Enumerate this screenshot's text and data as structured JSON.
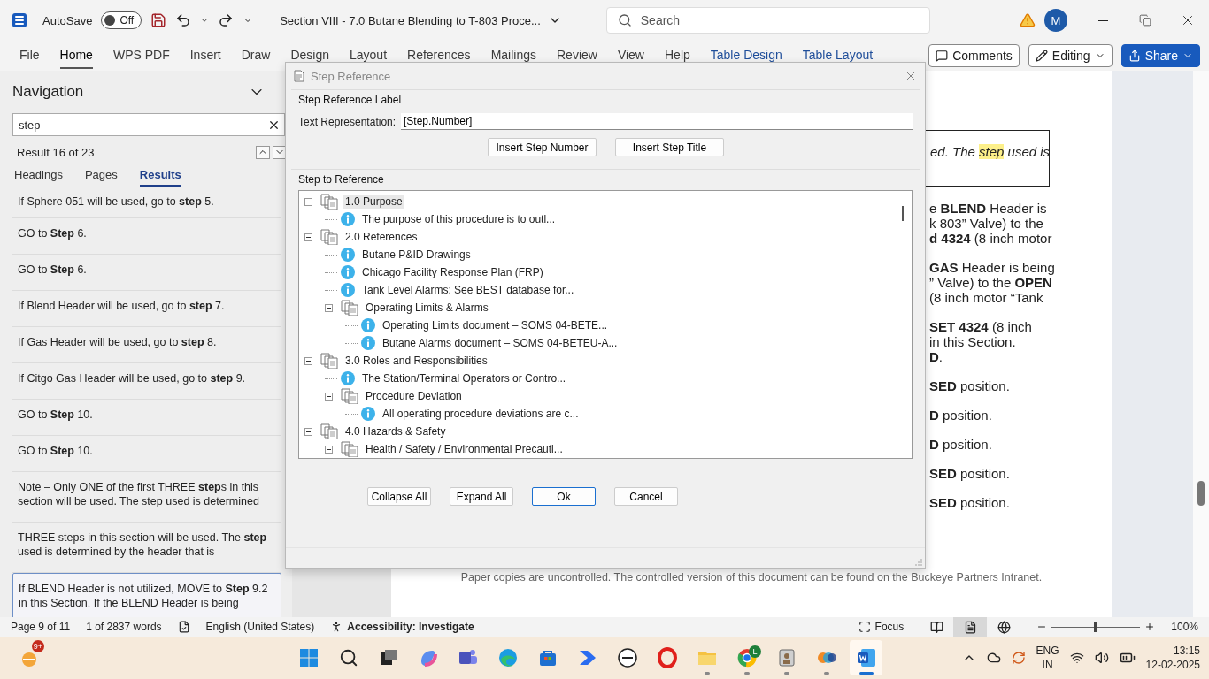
{
  "title_bar": {
    "autosave_label": "AutoSave",
    "autosave_toggle": {
      "label": "Off",
      "on": false
    },
    "document_title": "Section VIII - 7.0 Butane Blending to T-803 Proce...",
    "search_placeholder": "Search",
    "avatar": "M"
  },
  "ribbon": {
    "tabs": [
      {
        "label": "File",
        "selected": false,
        "kind": "normal"
      },
      {
        "label": "Home",
        "selected": true,
        "kind": "normal"
      },
      {
        "label": "WPS PDF",
        "selected": false,
        "kind": "normal"
      },
      {
        "label": "Insert",
        "selected": false,
        "kind": "normal"
      },
      {
        "label": "Draw",
        "selected": false,
        "kind": "normal"
      },
      {
        "label": "Design",
        "selected": false,
        "kind": "normal"
      },
      {
        "label": "Layout",
        "selected": false,
        "kind": "normal"
      },
      {
        "label": "References",
        "selected": false,
        "kind": "normal"
      },
      {
        "label": "Mailings",
        "selected": false,
        "kind": "normal"
      },
      {
        "label": "Review",
        "selected": false,
        "kind": "normal"
      },
      {
        "label": "View",
        "selected": false,
        "kind": "normal"
      },
      {
        "label": "Help",
        "selected": false,
        "kind": "normal"
      },
      {
        "label": "Table Design",
        "selected": false,
        "kind": "contextual"
      },
      {
        "label": "Table Layout",
        "selected": false,
        "kind": "contextual"
      }
    ],
    "comments": "Comments",
    "editing": "Editing",
    "share": "Share"
  },
  "navigation": {
    "title": "Navigation",
    "search_value": "step",
    "result_count": "Result 16 of 23",
    "tabs": [
      {
        "label": "Headings",
        "selected": false
      },
      {
        "label": "Pages",
        "selected": false
      },
      {
        "label": "Results",
        "selected": true
      }
    ],
    "results": [
      {
        "text": "If Sphere 051 will be used, go to **step** 5.",
        "selected": false
      },
      {
        "text": "GO to **Step** 6.",
        "selected": false
      },
      {
        "text": "GO to **Step** 6.",
        "selected": false
      },
      {
        "text": "If Blend Header will be used, go to **step** 7.",
        "selected": false
      },
      {
        "text": "If Gas Header will be used, go to **step** 8.",
        "selected": false
      },
      {
        "text": "If Citgo Gas Header will be used, go to **step** 9.",
        "selected": false
      },
      {
        "text": "GO to **Step** 10.",
        "selected": false
      },
      {
        "text": "GO to **Step** 10.",
        "selected": false
      },
      {
        "text": "Note – Only ONE of the first THREE **step**s in this section will be used. The step used is determined",
        "selected": false
      },
      {
        "text": "THREE steps in this section will be used. The **step** used is determined by the header that is",
        "selected": false
      },
      {
        "text": "If BLEND Header is not utilized, MOVE to **Step** 9.2 in this Section. If the BLEND Header is being",
        "selected": true
      }
    ]
  },
  "document": {
    "note_box": {
      "before": "ed. The",
      "highlight": "step",
      "after": "used is"
    },
    "paragraphs": [
      [
        "e **BLEND** Header is",
        "k 803” Valve) to the",
        "**d 4324** (8 inch motor"
      ],
      [
        "**GAS** Header is being",
        "” Valve) to the **OPEN**",
        "(8 inch motor “Tank"
      ],
      [
        "**SET 4324** (8 inch",
        "in this Section.",
        "**D**."
      ],
      [
        "**SED** position."
      ],
      [
        "**D** position."
      ],
      [
        "**D** position."
      ],
      [
        "**SED** position."
      ],
      [
        "**SED** position."
      ]
    ],
    "footer": "Paper copies are uncontrolled. The controlled version of this document can be found on the Buckeye Partners Intranet."
  },
  "dialog": {
    "title": "Step Reference",
    "label_group": "Step Reference Label",
    "text_representation_label": "Text Representation:",
    "text_representation_value": "[Step.Number]",
    "insert_buttons": [
      "Insert Step Number",
      "Insert Step Title"
    ],
    "tree_group": "Step to Reference",
    "tree": [
      {
        "label": "1.0 Purpose",
        "kind": "section",
        "expanded": true,
        "selected": true,
        "children": [
          {
            "label": "The purpose of this procedure is to outl...",
            "kind": "info",
            "selected": false
          }
        ]
      },
      {
        "label": "2.0 References",
        "kind": "section",
        "expanded": true,
        "selected": false,
        "children": [
          {
            "label": "Butane P&ID Drawings",
            "kind": "info",
            "selected": false
          },
          {
            "label": "Chicago Facility Response Plan (FRP)",
            "kind": "info",
            "selected": false
          },
          {
            "label": "Tank Level Alarms: See BEST database for...",
            "kind": "info",
            "selected": false
          },
          {
            "label": "Operating Limits & Alarms",
            "kind": "section",
            "expanded": true,
            "selected": false,
            "children": [
              {
                "label": "Operating Limits document – SOMS 04-BETE...",
                "kind": "info",
                "selected": false
              },
              {
                "label": "Butane Alarms document – SOMS 04-BETEU-A...",
                "kind": "info",
                "selected": false
              }
            ]
          }
        ]
      },
      {
        "label": "3.0 Roles and Responsibilities",
        "kind": "section",
        "expanded": true,
        "selected": false,
        "children": [
          {
            "label": "The Station/Terminal Operators or Contro...",
            "kind": "info",
            "selected": false
          },
          {
            "label": "Procedure Deviation",
            "kind": "section",
            "expanded": true,
            "selected": false,
            "children": [
              {
                "label": "All operating procedure deviations are c...",
                "kind": "info",
                "selected": false
              }
            ]
          }
        ]
      },
      {
        "label": "4.0 Hazards & Safety",
        "kind": "section",
        "expanded": true,
        "selected": false,
        "children": [
          {
            "label": "Health / Safety / Environmental Precauti...",
            "kind": "section",
            "expanded": true,
            "selected": false
          }
        ]
      }
    ],
    "buttons": [
      {
        "label": "Collapse All",
        "default": false
      },
      {
        "label": "Expand All",
        "default": false
      },
      {
        "label": "Ok",
        "default": true
      },
      {
        "label": "Cancel",
        "default": false
      }
    ]
  },
  "status_bar": {
    "page": "Page 9 of 11",
    "words": "1 of 2837 words",
    "language": "English (United States)",
    "accessibility": "Accessibility: Investigate",
    "focus": "Focus",
    "views": [
      {
        "kind": "read",
        "selected": false
      },
      {
        "kind": "print",
        "selected": true
      },
      {
        "kind": "web",
        "selected": false
      }
    ],
    "zoom": {
      "level": 0.5,
      "reading": "100%"
    }
  },
  "taskbar": {
    "widget_badge": "9+",
    "apps": [
      {
        "kind": "start",
        "running": false,
        "active": false
      },
      {
        "kind": "search",
        "running": false,
        "active": false
      },
      {
        "kind": "taskview",
        "running": false,
        "active": false
      },
      {
        "kind": "copilot",
        "running": false,
        "active": false
      },
      {
        "kind": "teams",
        "running": false,
        "active": false
      },
      {
        "kind": "edge",
        "running": false,
        "active": false
      },
      {
        "kind": "store",
        "running": false,
        "active": false
      },
      {
        "kind": "automate",
        "running": false,
        "active": false
      },
      {
        "kind": "dell",
        "running": false,
        "active": false
      },
      {
        "kind": "opera",
        "running": false,
        "active": false
      },
      {
        "kind": "explorer",
        "running": true,
        "active": false
      },
      {
        "kind": "chrome",
        "running": true,
        "active": false,
        "badge": "L"
      },
      {
        "kind": "viewer",
        "running": true,
        "active": false
      },
      {
        "kind": "bubbles",
        "running": true,
        "active": false
      },
      {
        "kind": "word",
        "running": true,
        "active": true
      }
    ],
    "language": "ENG",
    "region": "IN",
    "time": "13:15",
    "date": "12-02-2025"
  }
}
